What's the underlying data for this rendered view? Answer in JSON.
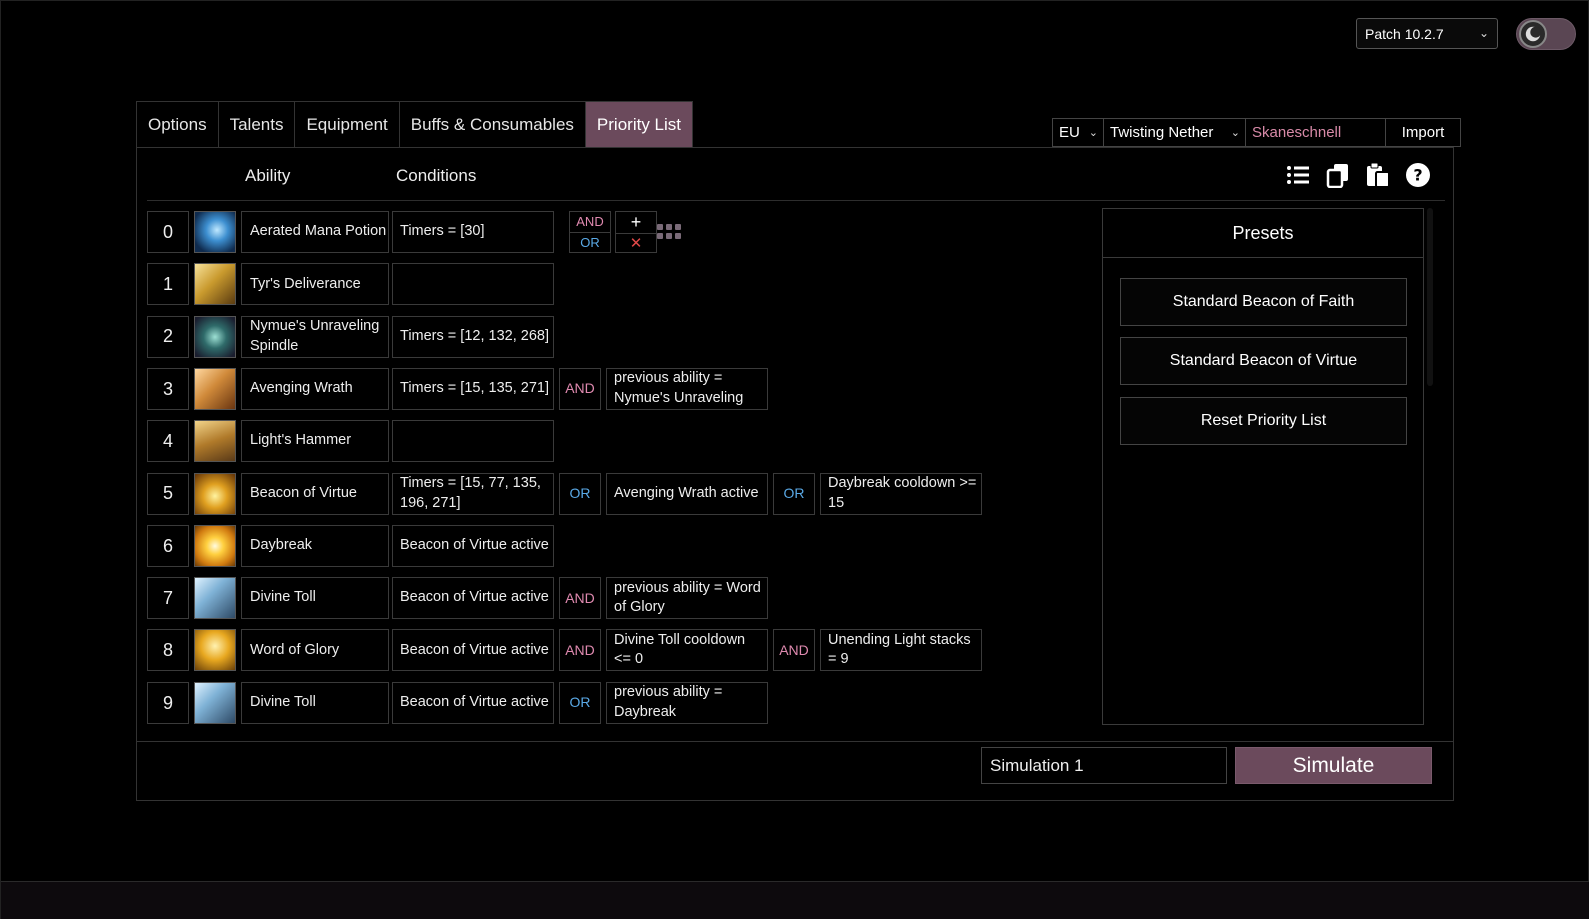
{
  "header": {
    "patch_label": "Patch 10.2.7"
  },
  "tabs": [
    {
      "label": "Options"
    },
    {
      "label": "Talents"
    },
    {
      "label": "Equipment"
    },
    {
      "label": "Buffs & Consumables"
    },
    {
      "label": "Priority List",
      "active": true
    }
  ],
  "character_import": {
    "region": "EU",
    "realm": "Twisting Nether",
    "name": "Skaneschnell",
    "import_label": "Import"
  },
  "columns": {
    "ability": "Ability",
    "conditions": "Conditions"
  },
  "toolbar_icons": [
    "list-icon",
    "copy-icon",
    "paste-icon",
    "help-icon"
  ],
  "rows": [
    {
      "index": "0",
      "icon": "aerated-mana-potion-icon",
      "name": "Aerated Mana Potion",
      "parts": [
        {
          "t": "cond",
          "text": "Timers = [30]"
        }
      ]
    },
    {
      "index": "1",
      "icon": "tyrs-deliverance-icon",
      "name": "Tyr's Deliverance",
      "parts": [
        {
          "t": "cond",
          "text": ""
        }
      ]
    },
    {
      "index": "2",
      "icon": "nymues-unraveling-spindle-icon",
      "name": "Nymue's Unraveling Spindle",
      "parts": [
        {
          "t": "cond",
          "text": "Timers = [12, 132, 268]"
        }
      ]
    },
    {
      "index": "3",
      "icon": "avenging-wrath-icon",
      "name": "Avenging Wrath",
      "parts": [
        {
          "t": "cond",
          "text": "Timers = [15, 135, 271]"
        },
        {
          "t": "op",
          "text": "AND"
        },
        {
          "t": "cond",
          "text": "previous ability = Nymue's Unraveling"
        }
      ]
    },
    {
      "index": "4",
      "icon": "lights-hammer-icon",
      "name": "Light's Hammer",
      "parts": [
        {
          "t": "cond",
          "text": ""
        }
      ]
    },
    {
      "index": "5",
      "icon": "beacon-of-virtue-icon",
      "name": "Beacon of Virtue",
      "parts": [
        {
          "t": "cond",
          "text": "Timers = [15, 77, 135, 196, 271]"
        },
        {
          "t": "op",
          "text": "OR"
        },
        {
          "t": "cond",
          "text": "Avenging Wrath active"
        },
        {
          "t": "op",
          "text": "OR"
        },
        {
          "t": "cond",
          "text": "Daybreak cooldown >= 15"
        }
      ]
    },
    {
      "index": "6",
      "icon": "daybreak-icon",
      "name": "Daybreak",
      "parts": [
        {
          "t": "cond",
          "text": "Beacon of Virtue active"
        }
      ]
    },
    {
      "index": "7",
      "icon": "divine-toll-icon",
      "name": "Divine Toll",
      "parts": [
        {
          "t": "cond",
          "text": "Beacon of Virtue active"
        },
        {
          "t": "op",
          "text": "AND"
        },
        {
          "t": "cond",
          "text": "previous ability = Word of Glory"
        }
      ]
    },
    {
      "index": "8",
      "icon": "word-of-glory-icon",
      "name": "Word of Glory",
      "parts": [
        {
          "t": "cond",
          "text": "Beacon of Virtue active"
        },
        {
          "t": "op",
          "text": "AND"
        },
        {
          "t": "cond",
          "text": "Divine Toll cooldown <= 0"
        },
        {
          "t": "op",
          "text": "AND"
        },
        {
          "t": "cond",
          "text": "Unending Light stacks = 9"
        }
      ]
    },
    {
      "index": "9",
      "icon": "divine-toll-icon",
      "name": "Divine Toll",
      "parts": [
        {
          "t": "cond",
          "text": "Beacon of Virtue active"
        },
        {
          "t": "op",
          "text": "OR"
        },
        {
          "t": "cond",
          "text": "previous ability = Daybreak"
        }
      ]
    }
  ],
  "row0_controls": {
    "and": "AND",
    "or": "OR",
    "add": "+",
    "remove": "✕"
  },
  "presets": {
    "title": "Presets",
    "items": [
      "Standard Beacon of Faith",
      "Standard Beacon of Virtue",
      "Reset Priority List"
    ]
  },
  "simulation": {
    "name_value": "Simulation 1",
    "button_label": "Simulate"
  },
  "colors": {
    "accent": "#6b4a5c",
    "and_op": "#e08ab0",
    "or_op": "#5aa9e6",
    "remove": "#e04848"
  }
}
